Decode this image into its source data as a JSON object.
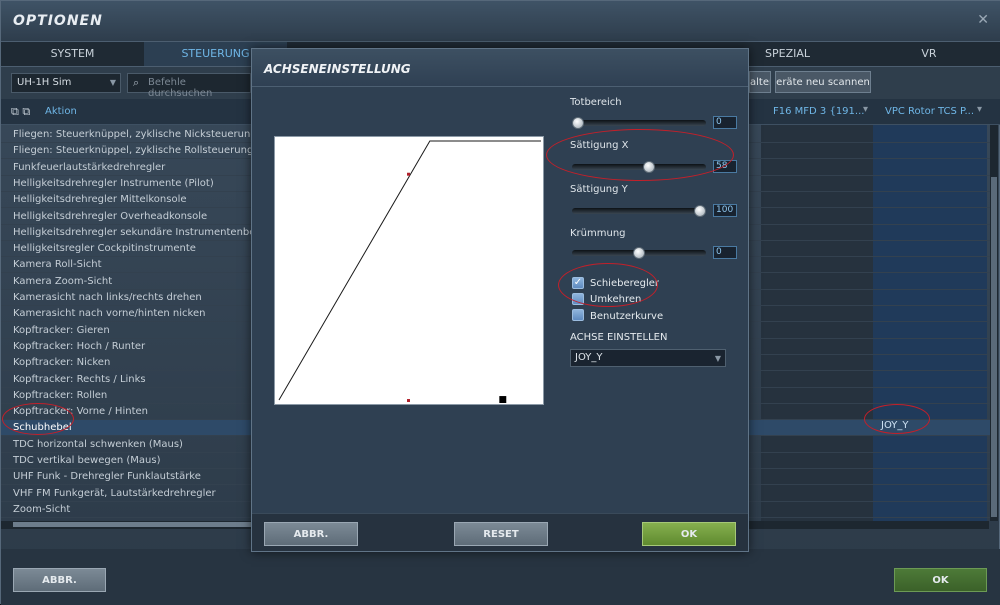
{
  "window": {
    "title": "OPTIONEN",
    "close_glyph": "✕"
  },
  "tabs": [
    {
      "label": "SYSTEM"
    },
    {
      "label": "STEUERUNG",
      "active": true
    },
    {
      "label": "SPEZIAL"
    },
    {
      "label": "VR"
    }
  ],
  "toolbar": {
    "aircraft": "UH-1H Sim",
    "search_placeholder": "Befehle durchsuchen",
    "btn_partial1": "alter",
    "btn_partial2": "eräte neu scannen"
  },
  "columns": {
    "action": "Aktion",
    "device1": "F16 MFD 3 {191...",
    "device2": "VPC Rotor TCS P..."
  },
  "actions": [
    "Fliegen: Steuerknüppel, zyklische Nicksteuerung",
    "Fliegen: Steuerknüppel, zyklische Rollsteuerung",
    "Funkfeuerlautstärkedrehregler",
    "Helligkeitsdrehregler Instrumente (Pilot)",
    "Helligkeitsdrehregler Mittelkonsole",
    "Helligkeitsdrehregler Overheadkonsole",
    "Helligkeitsdrehregler sekundäre Instrumentenbeleuchtung",
    "Helligkeitsregler Cockpitinstrumente",
    "Kamera Roll-Sicht",
    "Kamera Zoom-Sicht",
    "Kamerasicht nach links/rechts drehen",
    "Kamerasicht nach vorne/hinten nicken",
    "Kopftracker: Gieren",
    "Kopftracker: Hoch / Runter",
    "Kopftracker: Nicken",
    "Kopftracker: Rechts / Links",
    "Kopftracker: Rollen",
    "Kopftracker: Vorne / Hinten",
    "Schubhebel",
    "TDC horizontal schwenken (Maus)",
    "TDC vertikal bewegen (Maus)",
    "UHF Funk - Drehregler Funklautstärke",
    "VHF FM Funkgerät, Lautstärkedrehregler",
    "Zoom-Sicht"
  ],
  "selected_row_binding": "JOY_Y",
  "footer": {
    "cancel": "ABBR.",
    "ok": "OK"
  },
  "modal": {
    "title": "ACHSENEINSTELLUNG",
    "deadzone": {
      "label": "Totbereich",
      "value": "0",
      "fraction": 0.0
    },
    "saturation_x": {
      "label": "Sättigung X",
      "value": "58",
      "fraction": 0.58
    },
    "saturation_y": {
      "label": "Sättigung Y",
      "value": "100",
      "fraction": 1.0
    },
    "curvature": {
      "label": "Krümmung",
      "value": "0",
      "fraction": 0.5
    },
    "checkboxes": [
      {
        "label": "Schieberegler",
        "checked": true
      },
      {
        "label": "Umkehren",
        "checked": false
      },
      {
        "label": "Benutzerkurve",
        "checked": false
      }
    ],
    "axis_header": "ACHSE EINSTELLEN",
    "axis_value": "JOY_Y",
    "buttons": {
      "cancel": "ABBR.",
      "reset": "RESET",
      "ok": "OK"
    }
  },
  "colors": {
    "accent": "#6fb6e6",
    "ok_green": "#74a13f",
    "annotation_red": "#c2202a"
  }
}
